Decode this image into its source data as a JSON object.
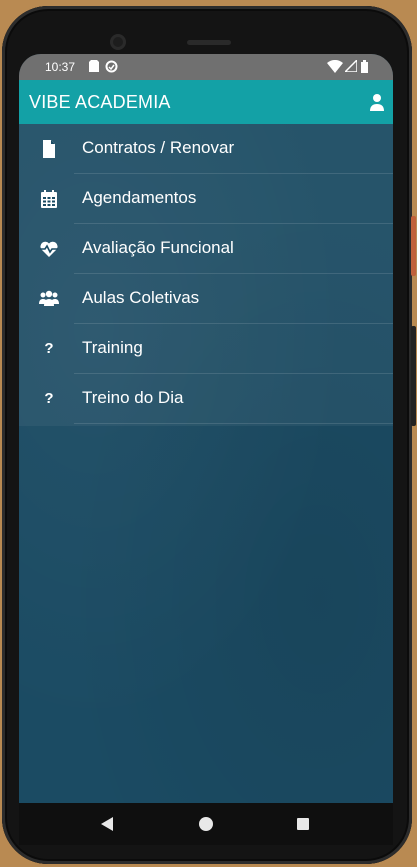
{
  "status_bar": {
    "time": "10:37",
    "icons": [
      "sd-card-icon",
      "data-saver-icon",
      "wifi-icon",
      "signal-icon",
      "battery-icon"
    ]
  },
  "app_bar": {
    "title": "VIBE ACADEMIA",
    "user_icon": "user-icon",
    "color": "#13a1a6"
  },
  "menu": {
    "items": [
      {
        "label": "Contratos / Renovar",
        "icon": "file-icon"
      },
      {
        "label": "Agendamentos",
        "icon": "calendar-icon"
      },
      {
        "label": "Avaliação Funcional",
        "icon": "heartbeat-icon"
      },
      {
        "label": "Aulas Coletivas",
        "icon": "users-icon"
      },
      {
        "label": "Training",
        "icon": "question-icon"
      },
      {
        "label": "Treino do Dia",
        "icon": "question-icon"
      }
    ]
  },
  "nav_bar": {
    "buttons": [
      "back-icon",
      "home-icon",
      "recents-icon"
    ]
  },
  "colors": {
    "background": "#1b4b63",
    "status_bar": "#707070"
  }
}
